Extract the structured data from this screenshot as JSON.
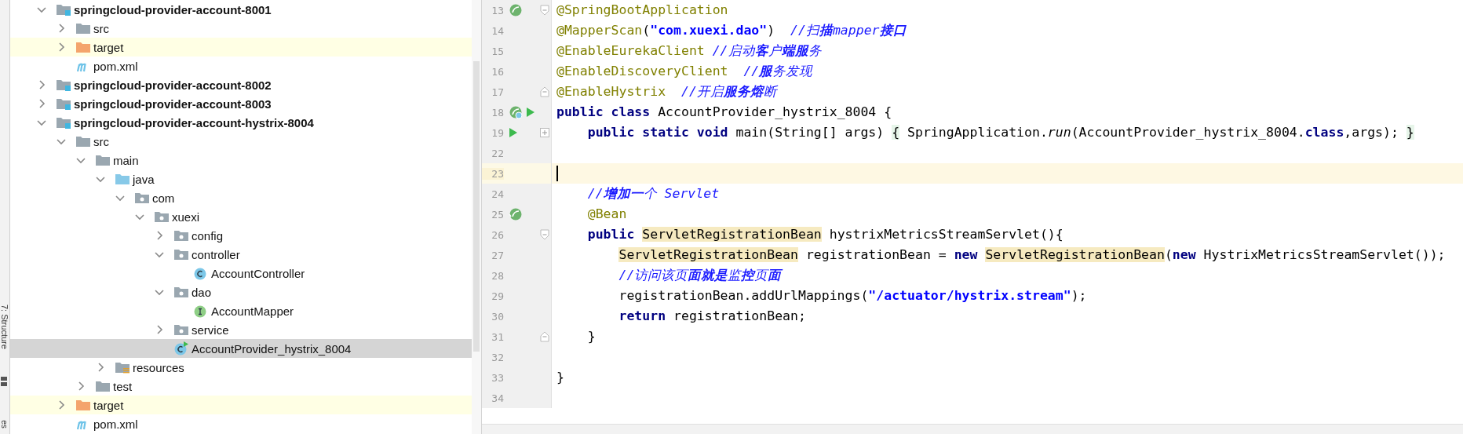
{
  "side_stripe": {
    "tool_window": "7: Structure",
    "bottom_label": "es"
  },
  "tree": [
    {
      "label": "springcloud-provider-account-8001",
      "kind": "module",
      "expanded": true,
      "selected": false,
      "children": [
        {
          "label": "src",
          "kind": "folder",
          "expanded": false,
          "selected": false
        },
        {
          "label": "target",
          "kind": "excluded",
          "expanded": false,
          "selected": false
        },
        {
          "label": "pom.xml",
          "kind": "maven",
          "selected": false
        }
      ]
    },
    {
      "label": "springcloud-provider-account-8002",
      "kind": "module",
      "expanded": false,
      "selected": false
    },
    {
      "label": "springcloud-provider-account-8003",
      "kind": "module",
      "expanded": false,
      "selected": false
    },
    {
      "label": "springcloud-provider-account-hystrix-8004",
      "kind": "module",
      "expanded": true,
      "selected": false,
      "children": [
        {
          "label": "src",
          "kind": "folder",
          "expanded": true,
          "selected": false,
          "children": [
            {
              "label": "main",
              "kind": "folder",
              "expanded": true,
              "selected": false,
              "children": [
                {
                  "label": "java",
                  "kind": "source",
                  "expanded": true,
                  "selected": false,
                  "children": [
                    {
                      "label": "com",
                      "kind": "package",
                      "expanded": true,
                      "selected": false,
                      "children": [
                        {
                          "label": "xuexi",
                          "kind": "package",
                          "expanded": true,
                          "selected": false,
                          "children": [
                            {
                              "label": "config",
                              "kind": "package",
                              "expanded": false,
                              "selected": false
                            },
                            {
                              "label": "controller",
                              "kind": "package",
                              "expanded": true,
                              "selected": false,
                              "children": [
                                {
                                  "label": "AccountController",
                                  "kind": "class",
                                  "selected": false
                                }
                              ]
                            },
                            {
                              "label": "dao",
                              "kind": "package",
                              "expanded": true,
                              "selected": false,
                              "children": [
                                {
                                  "label": "AccountMapper",
                                  "kind": "interface",
                                  "selected": false
                                }
                              ]
                            },
                            {
                              "label": "service",
                              "kind": "package",
                              "expanded": false,
                              "selected": false
                            },
                            {
                              "label": "AccountProvider_hystrix_8004",
                              "kind": "main-class",
                              "selected": true
                            }
                          ]
                        }
                      ]
                    }
                  ]
                },
                {
                  "label": "resources",
                  "kind": "resources",
                  "expanded": false,
                  "selected": false
                }
              ]
            },
            {
              "label": "test",
              "kind": "folder",
              "expanded": false,
              "selected": false
            }
          ]
        },
        {
          "label": "target",
          "kind": "excluded",
          "expanded": false,
          "selected": false
        },
        {
          "label": "pom.xml",
          "kind": "maven",
          "selected": false
        }
      ]
    }
  ],
  "editor": {
    "lines": [
      {
        "number": "13",
        "current": false,
        "gutter_icons": [
          {
            "kind": "spring-bean"
          }
        ],
        "fold_marker": {
          "kind": "start"
        },
        "tokens": [
          {
            "kind": "annotation",
            "text": "@SpringBootApplication"
          }
        ]
      },
      {
        "number": "14",
        "current": false,
        "tokens": [
          {
            "kind": "annotation",
            "text": "@MapperScan"
          },
          {
            "kind": "plain",
            "text": "("
          },
          {
            "kind": "string",
            "text": "\"com.xuexi.dao\""
          },
          {
            "kind": "plain",
            "text": ")  "
          },
          {
            "kind": "comment",
            "text": "//扫**描**mapper**接口**"
          }
        ]
      },
      {
        "number": "15",
        "current": false,
        "tokens": [
          {
            "kind": "annotation",
            "text": "@EnableEurekaClient"
          },
          {
            "kind": "comment",
            "text": " //启动**客**户**端服**务"
          }
        ]
      },
      {
        "number": "16",
        "current": false,
        "tokens": [
          {
            "kind": "annotation",
            "text": "@EnableDiscoveryClient"
          },
          {
            "kind": "comment",
            "text": "  //**服**务发现"
          }
        ]
      },
      {
        "number": "17",
        "current": false,
        "fold_marker": {
          "kind": "end"
        },
        "tokens": [
          {
            "kind": "annotation",
            "text": "@EnableHystrix"
          },
          {
            "kind": "comment",
            "text": "  //开启**服务熔**断"
          }
        ]
      },
      {
        "number": "18",
        "current": false,
        "gutter_icons": [
          {
            "kind": "spring-class"
          },
          {
            "kind": "run"
          }
        ],
        "tokens": [
          {
            "kind": "keyword",
            "text": "public class"
          },
          {
            "kind": "plain",
            "text": " AccountProvider_hystrix_8004 {"
          }
        ]
      },
      {
        "number": "19",
        "current": false,
        "gutter_icons": [
          {
            "kind": "run"
          }
        ],
        "fold_marker": {
          "kind": "collapsed"
        },
        "tokens": [
          {
            "kind": "keyword",
            "text": "    public static void"
          },
          {
            "kind": "plain",
            "text": " main(String[] args) "
          },
          {
            "kind": "folded",
            "text": "{"
          },
          {
            "kind": "plain",
            "text": " SpringApplication."
          },
          {
            "kind": "static",
            "text": "run"
          },
          {
            "kind": "plain",
            "text": "(AccountProvider_hystrix_8004."
          },
          {
            "kind": "keyword",
            "text": "class"
          },
          {
            "kind": "plain",
            "text": ",args); "
          },
          {
            "kind": "folded",
            "text": "}"
          }
        ]
      },
      {
        "number": "22",
        "current": false
      },
      {
        "number": "23",
        "current": true
      },
      {
        "number": "24",
        "current": false,
        "tokens": [
          {
            "kind": "comment",
            "text": "    //**增加一**个 Servlet"
          }
        ]
      },
      {
        "number": "25",
        "current": false,
        "gutter_icons": [
          {
            "kind": "bean"
          }
        ],
        "tokens": [
          {
            "kind": "annotation",
            "text": "    @Bean"
          }
        ]
      },
      {
        "number": "26",
        "current": false,
        "fold_marker": {
          "kind": "start"
        },
        "tokens": [
          {
            "kind": "keyword",
            "text": "    public "
          },
          {
            "kind": "usage",
            "text": "ServletRegistrationBean"
          },
          {
            "kind": "plain",
            "text": " hystrixMetricsStreamServlet(){"
          }
        ]
      },
      {
        "number": "27",
        "current": false,
        "tokens": [
          {
            "kind": "usage",
            "text": "        ServletRegistrationBean"
          },
          {
            "kind": "plain",
            "text": " registrationBean = "
          },
          {
            "kind": "keyword",
            "text": "new "
          },
          {
            "kind": "usage",
            "text": "ServletRegistrationBean"
          },
          {
            "kind": "plain",
            "text": "("
          },
          {
            "kind": "keyword",
            "text": "new"
          },
          {
            "kind": "plain",
            "text": " HystrixMetricsStreamServlet());"
          }
        ]
      },
      {
        "number": "28",
        "current": false,
        "tokens": [
          {
            "kind": "comment",
            "text": "        //访问该页**面就是**监**控**页**面**"
          }
        ]
      },
      {
        "number": "29",
        "current": false,
        "tokens": [
          {
            "kind": "plain",
            "text": "        registrationBean.addUrlMappings("
          },
          {
            "kind": "string",
            "text": "\"/actuator/hystrix.stream\""
          },
          {
            "kind": "plain",
            "text": ");"
          }
        ]
      },
      {
        "number": "30",
        "current": false,
        "tokens": [
          {
            "kind": "keyword",
            "text": "        return"
          },
          {
            "kind": "plain",
            "text": " registrationBean;"
          }
        ]
      },
      {
        "number": "31",
        "current": false,
        "fold_marker": {
          "kind": "end"
        },
        "tokens": [
          {
            "kind": "plain",
            "text": "    }"
          }
        ]
      },
      {
        "number": "32",
        "current": false
      },
      {
        "number": "33",
        "current": false,
        "tokens": [
          {
            "kind": "plain",
            "text": "}"
          }
        ]
      },
      {
        "number": "34",
        "current": false
      }
    ]
  }
}
